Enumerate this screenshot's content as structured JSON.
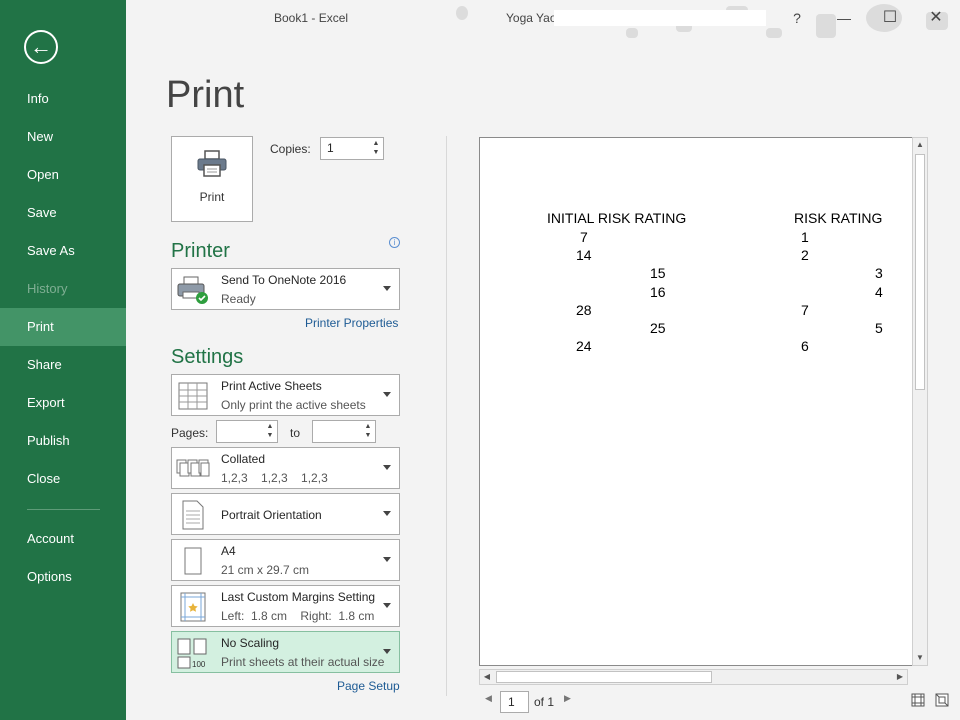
{
  "window": {
    "title": "Book1 - Excel",
    "user": "Yoga Yao",
    "help": "?",
    "minimize": "—",
    "restore": "☐",
    "close": "✕"
  },
  "nav": {
    "back_icon": "←",
    "items": [
      "Info",
      "New",
      "Open",
      "Save",
      "Save As",
      "History",
      "Print",
      "Share",
      "Export",
      "Publish",
      "Close"
    ],
    "bottom_items": [
      "Account",
      "Options"
    ],
    "active": "Print",
    "disabled": [
      "History"
    ]
  },
  "page": {
    "heading": "Print"
  },
  "print_button": {
    "label": "Print",
    "icon": "printer-icon"
  },
  "copies": {
    "label": "Copies:",
    "value": "1"
  },
  "printer": {
    "section": "Printer",
    "name": "Send To OneNote 2016",
    "status": "Ready",
    "properties_link": "Printer Properties",
    "info_icon": "i"
  },
  "settings": {
    "section": "Settings",
    "what": {
      "title": "Print Active Sheets",
      "desc": "Only print the active sheets"
    },
    "pages": {
      "label": "Pages:",
      "from": "",
      "to_label": "to",
      "to": ""
    },
    "collation": {
      "title": "Collated",
      "desc": "1,2,3    1,2,3    1,2,3"
    },
    "orientation": {
      "title": "Portrait Orientation"
    },
    "paper": {
      "title": "A4",
      "desc": "21 cm x 29.7 cm"
    },
    "margins": {
      "title": "Last Custom Margins Setting",
      "desc": "Left:  1.8 cm    Right:  1.8 cm"
    },
    "scaling": {
      "title": "No Scaling",
      "desc": "Print sheets at their actual size",
      "icon_text": "100"
    },
    "page_setup_link": "Page Setup"
  },
  "preview": {
    "headers": [
      "INITIAL RISK RATING",
      "RISK RATING"
    ],
    "cells": [
      "7",
      "14",
      "15",
      "16",
      "28",
      "25",
      "24",
      "1",
      "2",
      "3",
      "4",
      "7",
      "5",
      "6"
    ],
    "current_page": "1",
    "of_pages": "of 1"
  },
  "colors": {
    "accent": "#217346",
    "nav_active": "#439467",
    "highlight": "#d3f0e0"
  }
}
